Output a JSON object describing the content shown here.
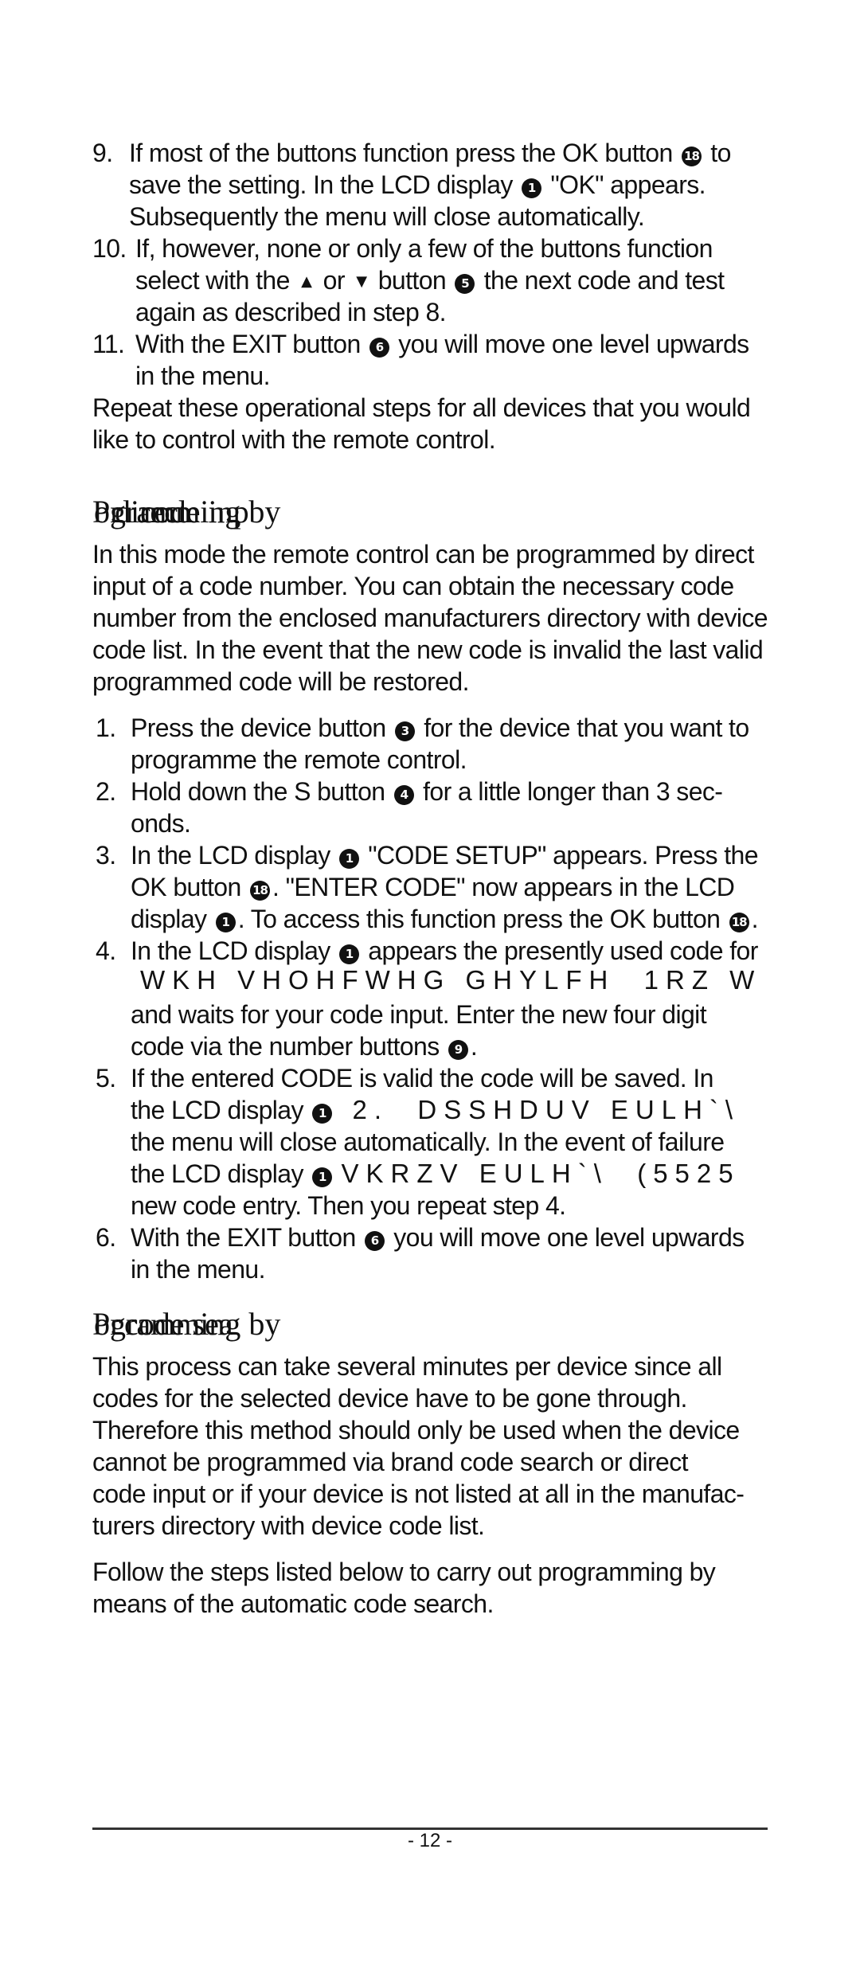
{
  "top_list": [
    {
      "num": "9.",
      "lines": [
        "If most of the buttons function press the OK button",
        "save the setting. In the LCD display",
        "Subsequently the menu will close automatically."
      ],
      "badge_18": "18",
      "badge_1": "1",
      "tail1": "to",
      "tail2": "\"OK\" appears."
    },
    {
      "num": "10.",
      "lines": [
        "If, however, none or only a few of the buttons function",
        "select with the",
        "or",
        "button",
        "the next code and test",
        "again as described in step 8."
      ],
      "badge_5": "5"
    },
    {
      "num": "11.",
      "lines": [
        "With the EXIT button",
        "you will move one level upwards",
        "in the menu."
      ],
      "badge_6": "6"
    }
  ],
  "repeat_para": [
    "Repeat these operational steps for all devices that you would",
    "like to control with the remote control."
  ],
  "heading1": {
    "layers": [
      "Pr",
      "ogramming by",
      "direct",
      "code inp",
      "ut"
    ],
    "visible": "Programming by direct code input"
  },
  "intro1": [
    "In this mode the remote control can be programmed by direct",
    "input of a code number. You can obtain the necessary code",
    "number from the enclosed manufacturers directory with device",
    "code list. In the event that the new code is invalid the last valid",
    "programmed code will be restored."
  ],
  "steps": {
    "s1": {
      "num": "1.",
      "a": "Press the device button",
      "badge": "3",
      "b": "for the device that you want to",
      "c": "programme the remote control."
    },
    "s2": {
      "num": "2.",
      "a": "Hold down the S button",
      "badge": "4",
      "b": "for a little longer than 3 sec-",
      "c": "onds."
    },
    "s3": {
      "num": "3.",
      "a": "In the LCD display",
      "badge1": "1",
      "b": "\"CODE SETUP\" appears. Press the",
      "c": "OK button",
      "badge18": "18",
      "d": ".  \"ENTER CODE\" now appears in the LCD",
      "e": "display",
      "f": ".  To access this function press the OK button",
      "g": "."
    },
    "s4": {
      "num": "4.",
      "a": "In the LCD display",
      "badge": "1",
      "b": "appears the presently used code for",
      "garble": "WKH VHOHFWHG GHYLFH  1RZ W",
      "c": "and waits for your code input. Enter the new four digit",
      "d": "code via the number buttons",
      "badge9": "9",
      "e": "."
    },
    "s5": {
      "num": "5.",
      "a": "If the entered CODE is valid the code will be saved. In",
      "b": "the LCD display",
      "badge": "1",
      "garble1": "2.  DSSHDUV EULH`\\",
      "c": "the menu will close automatically. In the event of failure",
      "d": "the LCD display",
      "garble2": "VKRZV EULH`\\  (5525",
      "e": "new code entry. Then you repeat step 4."
    },
    "s6": {
      "num": "6.",
      "a": "With the EXIT button",
      "badge": "6",
      "b": "you will move one level upwards",
      "c": "in the menu."
    }
  },
  "heading2": {
    "layers": [
      "Pr",
      "ogramming by",
      "code sea",
      "rch"
    ],
    "visible": "Programming by code search"
  },
  "intro2": [
    "This process can take several minutes per device since all",
    "codes for the selected device have to be gone through.",
    "Therefore this method should only be used when the device",
    "cannot be programmed via brand code search or direct",
    "code input or if your device is not listed at all in the manufac-",
    "turers directory with device code list."
  ],
  "follow": [
    "Follow the steps listed below to carry out programming by",
    "means of the automatic code search."
  ],
  "footer": {
    "page_number": "- 12 -"
  },
  "symbols": {
    "up": "▲",
    "down": "▼"
  }
}
